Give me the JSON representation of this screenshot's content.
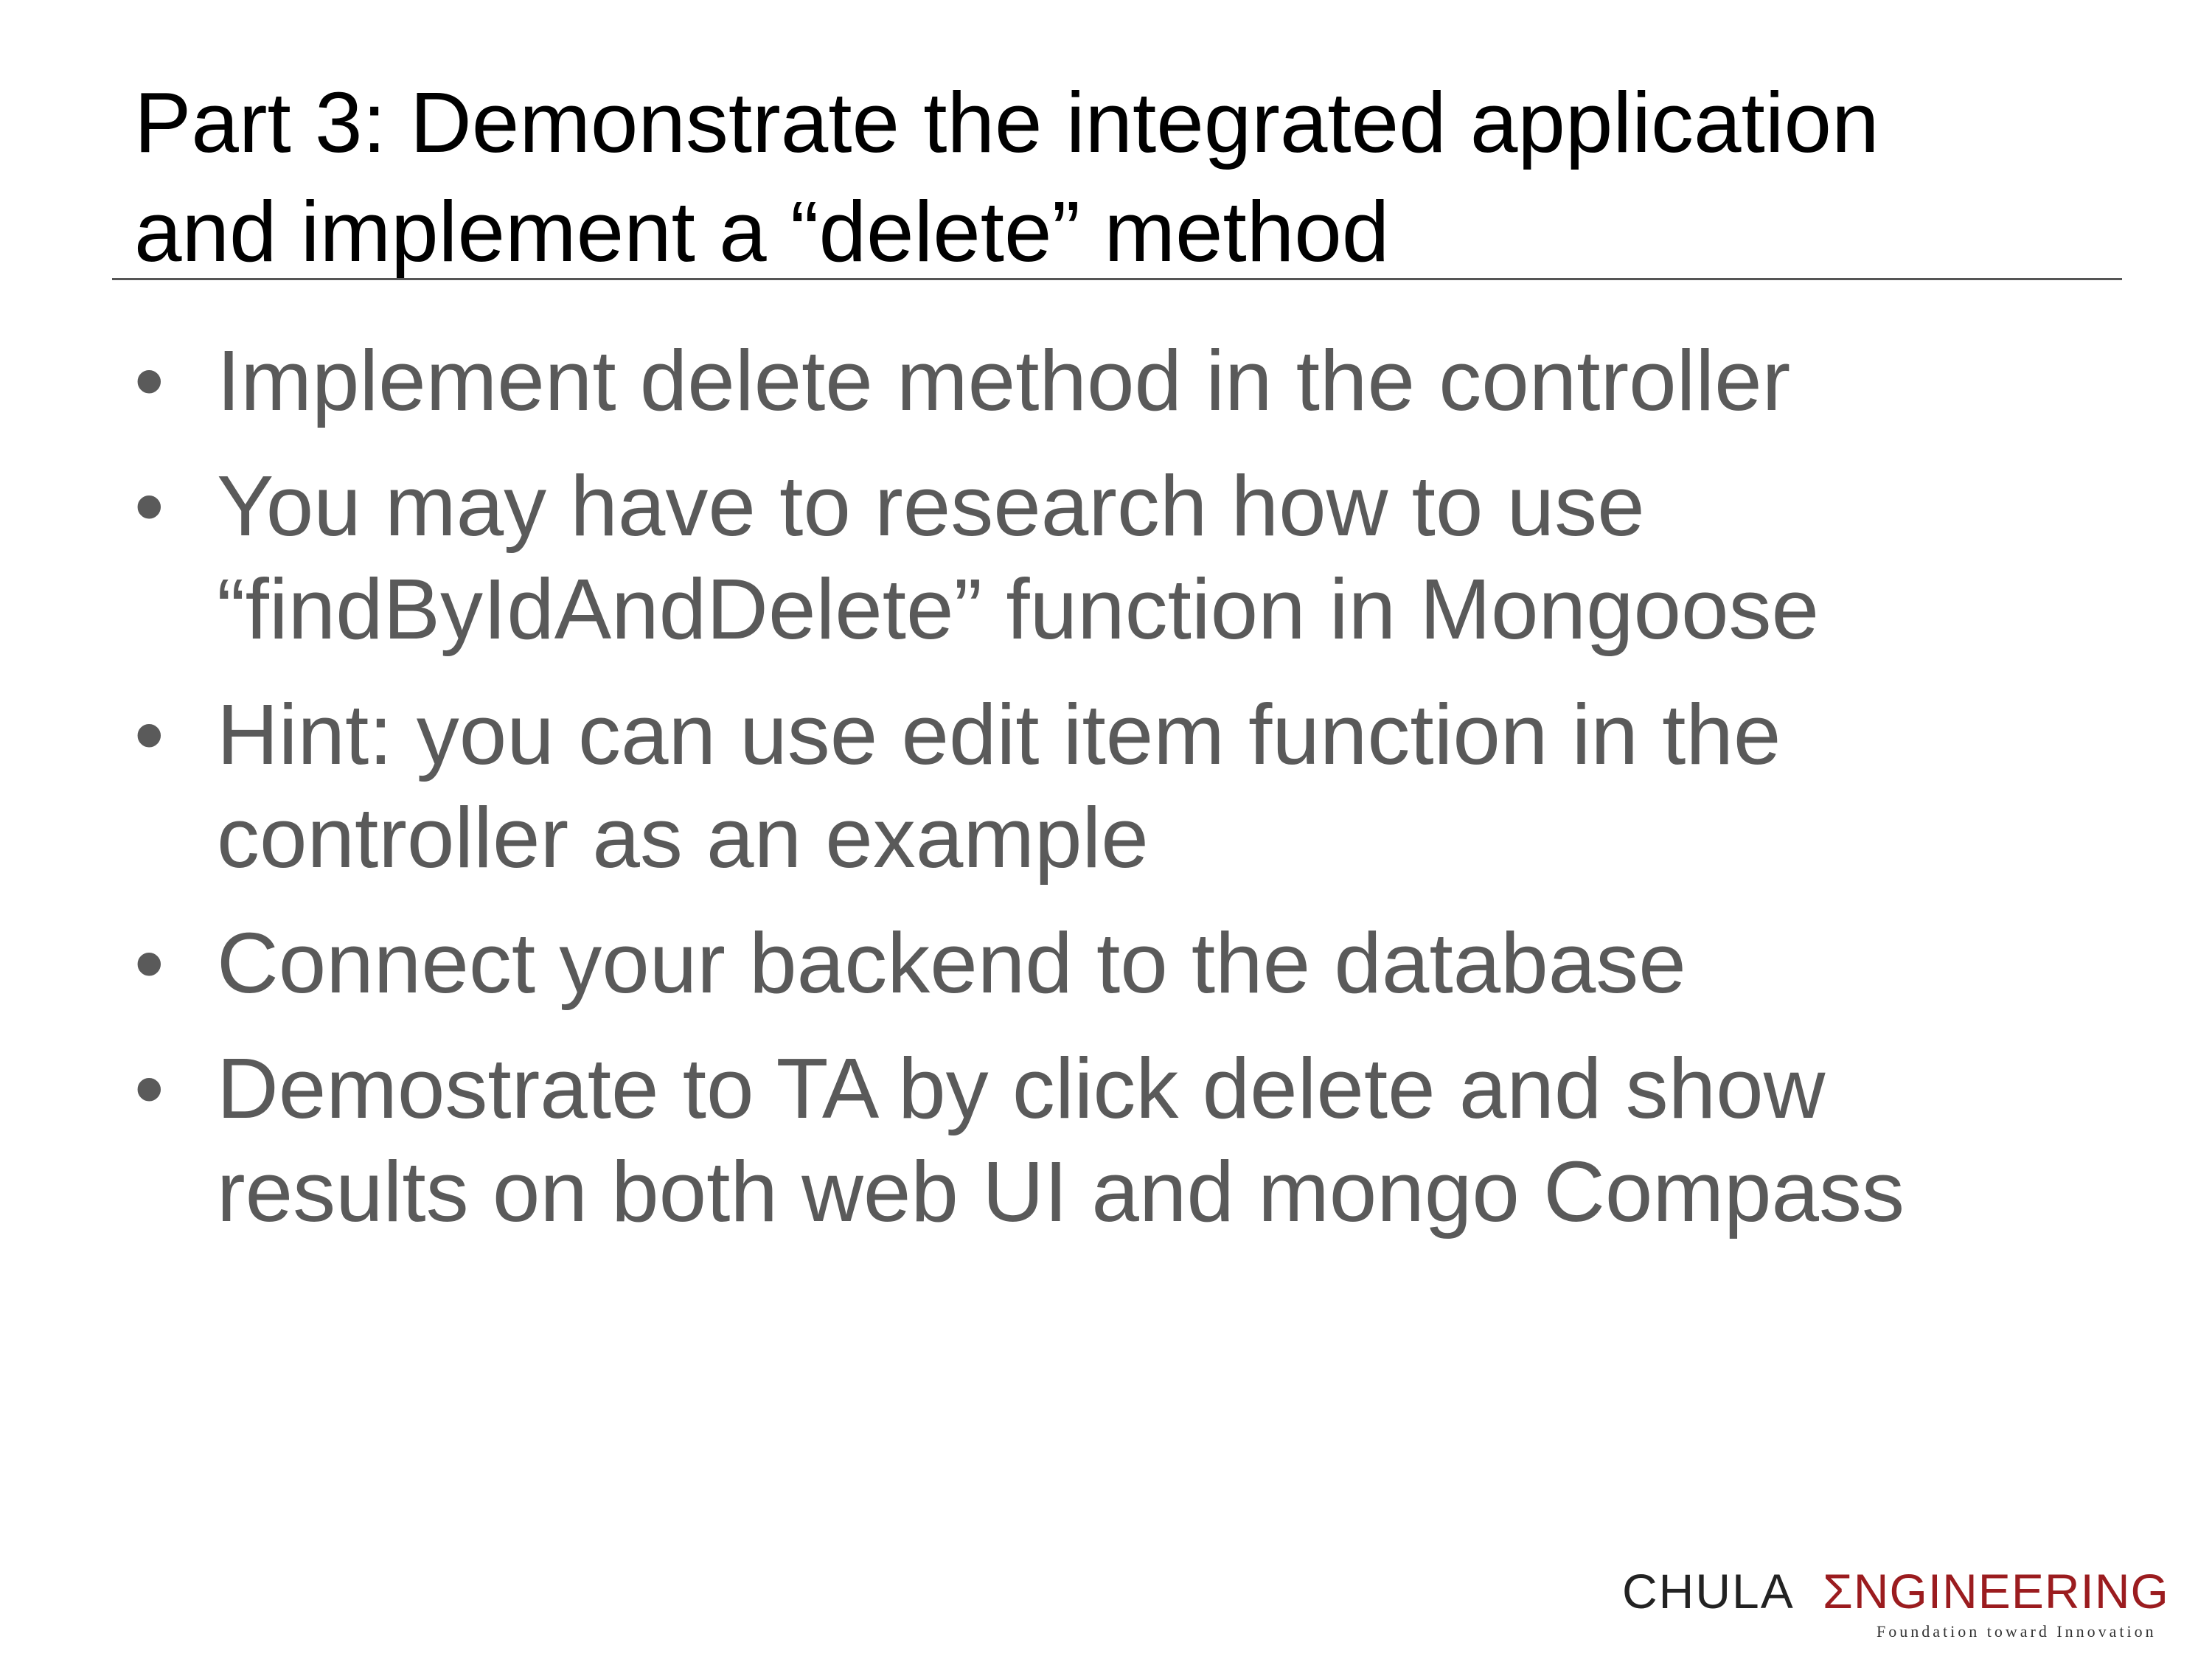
{
  "slide": {
    "title_lines": [
      "Part 3: Demonstrate the integrated application",
      "and implement a “delete” method"
    ],
    "bullets": [
      {
        "lines": [
          "Implement delete method in the controller"
        ]
      },
      {
        "lines": [
          "You may have to research how to use",
          "“findByIdAndDelete” function in Mongoose"
        ]
      },
      {
        "lines": [
          "Hint: you can use edit item function in the",
          "controller as an example"
        ]
      },
      {
        "lines": [
          "Connect your backend to the database"
        ]
      },
      {
        "lines": [
          "Demostrate to TA by click delete and show",
          "results on both web UI and mongo Compass"
        ]
      }
    ],
    "bullet_glyph": "•"
  },
  "logo": {
    "chula": "CHULA",
    "engineering": "ΣNGINEERING",
    "tagline": "Foundation toward Innovation"
  },
  "colors": {
    "title": "#000000",
    "body": "#5a5a5a",
    "logo_red": "#9b1c1f",
    "rule": "#555555"
  }
}
